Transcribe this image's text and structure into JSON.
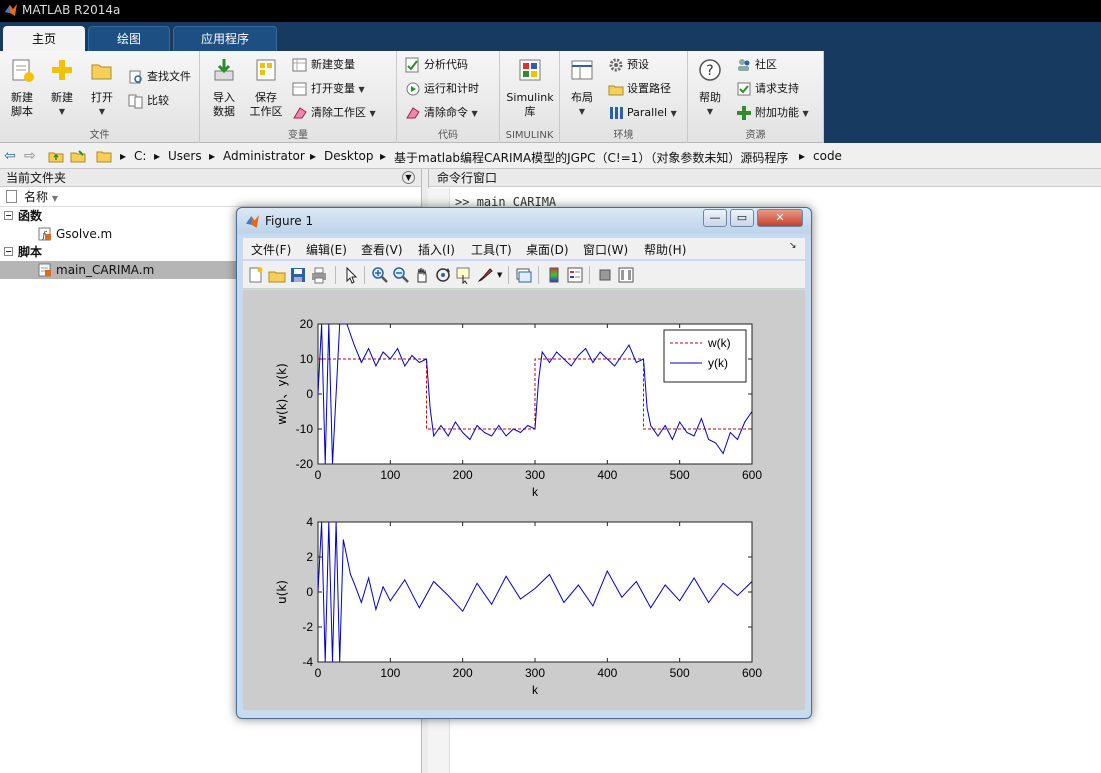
{
  "app": {
    "title": "MATLAB R2014a"
  },
  "tabs": [
    {
      "label": "主页"
    },
    {
      "label": "绘图"
    },
    {
      "label": "应用程序"
    }
  ],
  "ribbon": {
    "file": {
      "group_label": "文件",
      "new_script": [
        "新建",
        "脚本"
      ],
      "new": "新建",
      "open": "打开",
      "find_files": "查找文件",
      "compare": "比较"
    },
    "variable": {
      "group_label": "变量",
      "import": [
        "导入",
        "数据"
      ],
      "save": [
        "保存",
        "工作区"
      ],
      "new_var": "新建变量",
      "open_var": "打开变量",
      "clear_ws": "清除工作区"
    },
    "code": {
      "group_label": "代码",
      "analyze": "分析代码",
      "run_time": "运行和计时",
      "clear_cmd": "清除命令"
    },
    "simulink": {
      "group_label": "SIMULINK",
      "lib": [
        "Simulink",
        "库"
      ]
    },
    "env": {
      "group_label": "环境",
      "layout": "布局",
      "prefs": "预设",
      "set_path": "设置路径",
      "parallel": "Parallel"
    },
    "resources": {
      "group_label": "资源",
      "help": "帮助",
      "community": "社区",
      "support": "请求支持",
      "addons": "附加功能"
    }
  },
  "address": {
    "crumbs": [
      "C:",
      "Users",
      "Administrator",
      "Desktop",
      "基于matlab编程CARIMA模型的JGPC（C!=1）（对象参数未知）源码程序",
      "code"
    ]
  },
  "left_panel": {
    "title": "当前文件夹",
    "column_name": "名称",
    "sections": [
      {
        "label": "函数",
        "files": [
          "Gsolve.m"
        ]
      },
      {
        "label": "脚本",
        "files": [
          "main_CARIMA.m"
        ]
      }
    ]
  },
  "right_panel": {
    "title": "命令行窗口",
    "prompt": ">>",
    "command": "main_CARIMA"
  },
  "figure": {
    "title": "Figure 1",
    "menu": [
      "文件(F)",
      "编辑(E)",
      "查看(V)",
      "插入(I)",
      "工具(T)",
      "桌面(D)",
      "窗口(W)",
      "帮助(H)"
    ]
  },
  "colors": {
    "ref": "#cc0000",
    "series": "#0000cc",
    "ribbon_dark": "#173a61"
  },
  "chart_data": [
    {
      "type": "line",
      "xlabel": "k",
      "ylabel": "w(k)、y(k)",
      "xlim": [
        0,
        600
      ],
      "ylim": [
        -20,
        20
      ],
      "xticks": [
        0,
        100,
        200,
        300,
        400,
        500,
        600
      ],
      "yticks": [
        -20,
        -10,
        0,
        10,
        20
      ],
      "legend_position": "top-right",
      "series": [
        {
          "name": "w(k)",
          "style": "dashed",
          "color": "#cc0000",
          "x": [
            0,
            150,
            150,
            300,
            300,
            450,
            450,
            600
          ],
          "y": [
            10,
            10,
            -10,
            -10,
            10,
            10,
            -10,
            -10
          ]
        },
        {
          "name": "y(k)",
          "style": "solid",
          "color": "#0000cc",
          "x": [
            0,
            5,
            10,
            15,
            20,
            30,
            40,
            50,
            60,
            70,
            80,
            90,
            100,
            110,
            120,
            130,
            140,
            150,
            155,
            160,
            170,
            180,
            190,
            200,
            210,
            220,
            230,
            240,
            250,
            260,
            270,
            280,
            290,
            300,
            305,
            310,
            320,
            330,
            340,
            350,
            360,
            370,
            380,
            390,
            400,
            410,
            420,
            430,
            440,
            450,
            455,
            460,
            470,
            480,
            490,
            500,
            510,
            520,
            530,
            540,
            550,
            560,
            570,
            580,
            590,
            600
          ],
          "y": [
            0,
            20,
            -20,
            20,
            -20,
            20,
            20,
            14,
            9,
            13,
            8,
            12,
            10,
            13,
            8,
            11,
            9,
            10,
            -4,
            -12,
            -9,
            -12,
            -8,
            -11,
            -13,
            -9,
            -11,
            -12,
            -9,
            -12,
            -10,
            -11,
            -9,
            -10,
            4,
            12,
            9,
            12,
            10,
            8,
            11,
            13,
            9,
            12,
            10,
            8,
            11,
            14,
            9,
            10,
            -4,
            -9,
            -12,
            -9,
            -13,
            -8,
            -11,
            -12,
            -7,
            -13,
            -14,
            -17,
            -11,
            -13,
            -8,
            -5
          ]
        }
      ]
    },
    {
      "type": "line",
      "xlabel": "k",
      "ylabel": "u(k)",
      "xlim": [
        0,
        600
      ],
      "ylim": [
        -4,
        4
      ],
      "xticks": [
        0,
        100,
        200,
        300,
        400,
        500,
        600
      ],
      "yticks": [
        -4,
        -2,
        0,
        2,
        4
      ],
      "series": [
        {
          "style": "solid",
          "color": "#0000cc",
          "x": [
            0,
            5,
            10,
            15,
            20,
            25,
            30,
            35,
            40,
            45,
            50,
            60,
            70,
            80,
            90,
            100,
            120,
            140,
            160,
            180,
            200,
            220,
            240,
            260,
            280,
            300,
            320,
            340,
            360,
            380,
            400,
            420,
            440,
            460,
            480,
            500,
            520,
            540,
            560,
            580,
            600
          ],
          "y": [
            0,
            4,
            -4,
            4,
            -4,
            4,
            -4,
            3,
            2,
            1,
            0.5,
            -0.6,
            0.8,
            -1,
            0.3,
            -0.5,
            0.7,
            -0.9,
            0.6,
            -0.2,
            -1.1,
            0.5,
            -0.7,
            0.9,
            -0.4,
            0.2,
            1.0,
            -0.6,
            0.4,
            -0.8,
            1.2,
            -0.3,
            0.6,
            -0.9,
            0.4,
            -0.5,
            0.8,
            -0.6,
            0.5,
            -0.2,
            0.6
          ]
        }
      ]
    }
  ]
}
